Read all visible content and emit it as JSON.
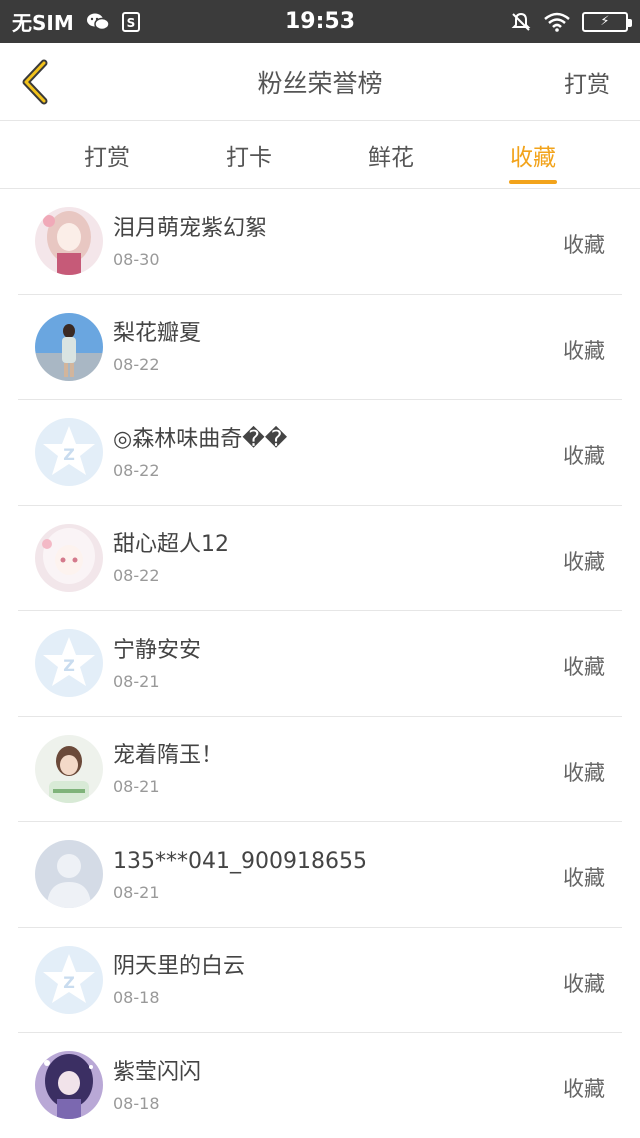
{
  "status_bar": {
    "carrier": "无SIM",
    "time": "19:53",
    "battery_charging": true
  },
  "header": {
    "title": "粉丝荣誉榜",
    "action": "打赏"
  },
  "tabs": [
    {
      "label": "打赏",
      "active": false
    },
    {
      "label": "打卡",
      "active": false
    },
    {
      "label": "鲜花",
      "active": false
    },
    {
      "label": "收藏",
      "active": true
    }
  ],
  "colors": {
    "accent": "#f2a31b",
    "status_bar_bg": "#3b3b3b"
  },
  "list": [
    {
      "name": "泪月萌宠紫幻絮",
      "date": "08-30",
      "action": "收藏",
      "avatar": "anime-girl-pink-avatar"
    },
    {
      "name": "梨花瓣夏",
      "date": "08-22",
      "action": "收藏",
      "avatar": "girl-sky-photo-avatar"
    },
    {
      "name": "◎森林味曲奇��",
      "date": "08-22",
      "action": "收藏",
      "avatar": "default-qq-avatar"
    },
    {
      "name": "甜心超人12",
      "date": "08-22",
      "action": "收藏",
      "avatar": "anime-girl-white-avatar"
    },
    {
      "name": "宁静安安",
      "date": "08-21",
      "action": "收藏",
      "avatar": "default-qq-avatar"
    },
    {
      "name": "宠着隋玉！",
      "date": "08-21",
      "action": "收藏",
      "avatar": "girl-green-photo-avatar"
    },
    {
      "name": "135***041_900918655",
      "date": "08-21",
      "action": "收藏",
      "avatar": "default-person-avatar"
    },
    {
      "name": "阴天里的白云",
      "date": "08-18",
      "action": "收藏",
      "avatar": "default-qq-avatar"
    },
    {
      "name": "紫莹闪闪",
      "date": "08-18",
      "action": "收藏",
      "avatar": "anime-girl-purple-avatar"
    }
  ]
}
